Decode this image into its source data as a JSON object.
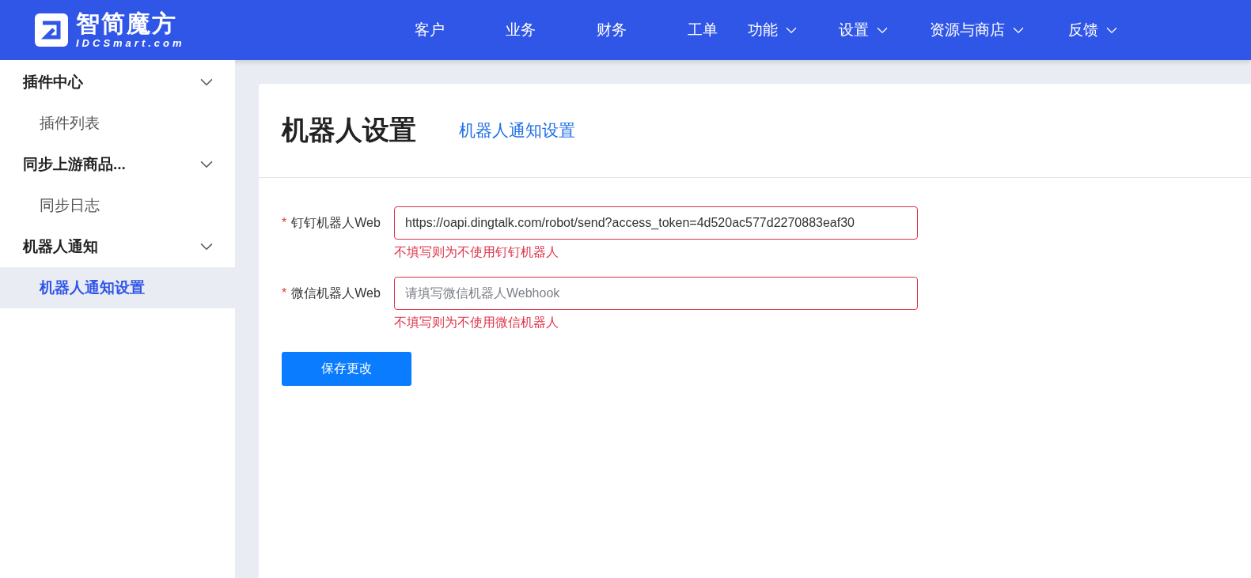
{
  "header": {
    "logo": {
      "title": "智简魔方",
      "subtitle": "IDCSmart.com"
    },
    "nav": [
      {
        "label": "客户",
        "dropdown": false
      },
      {
        "label": "业务",
        "dropdown": false
      },
      {
        "label": "财务",
        "dropdown": false
      },
      {
        "label": "工单",
        "dropdown": false
      },
      {
        "label": "功能",
        "dropdown": true
      },
      {
        "label": "设置",
        "dropdown": true
      },
      {
        "label": "资源与商店",
        "dropdown": true
      },
      {
        "label": "反馈",
        "dropdown": true
      }
    ]
  },
  "sidebar": {
    "groups": [
      {
        "label": "插件中心",
        "expanded": true,
        "children": [
          {
            "label": "插件列表",
            "selected": false
          }
        ]
      },
      {
        "label": "同步上游商品...",
        "expanded": true,
        "children": [
          {
            "label": "同步日志",
            "selected": false
          }
        ]
      },
      {
        "label": "机器人通知",
        "expanded": true,
        "children": [
          {
            "label": "机器人通知设置",
            "selected": true
          }
        ]
      }
    ]
  },
  "page": {
    "title": "机器人设置",
    "tabs": [
      {
        "label": "机器人通知设置",
        "selected": true
      }
    ],
    "form": {
      "fields": [
        {
          "label": "钉钉机器人Web",
          "required_mark": "*",
          "value": "https://oapi.dingtalk.com/robot/send?access_token=4d520ac577d2270883eaf30",
          "invalid": true,
          "error": "不填写则为不使用钉钉机器人"
        },
        {
          "label": "微信机器人Web",
          "required_mark": "*",
          "placeholder": "请填写微信机器人Webhook",
          "invalid": true,
          "error": "不填写则为不使用微信机器人"
        }
      ],
      "submit": "保存更改"
    }
  }
}
